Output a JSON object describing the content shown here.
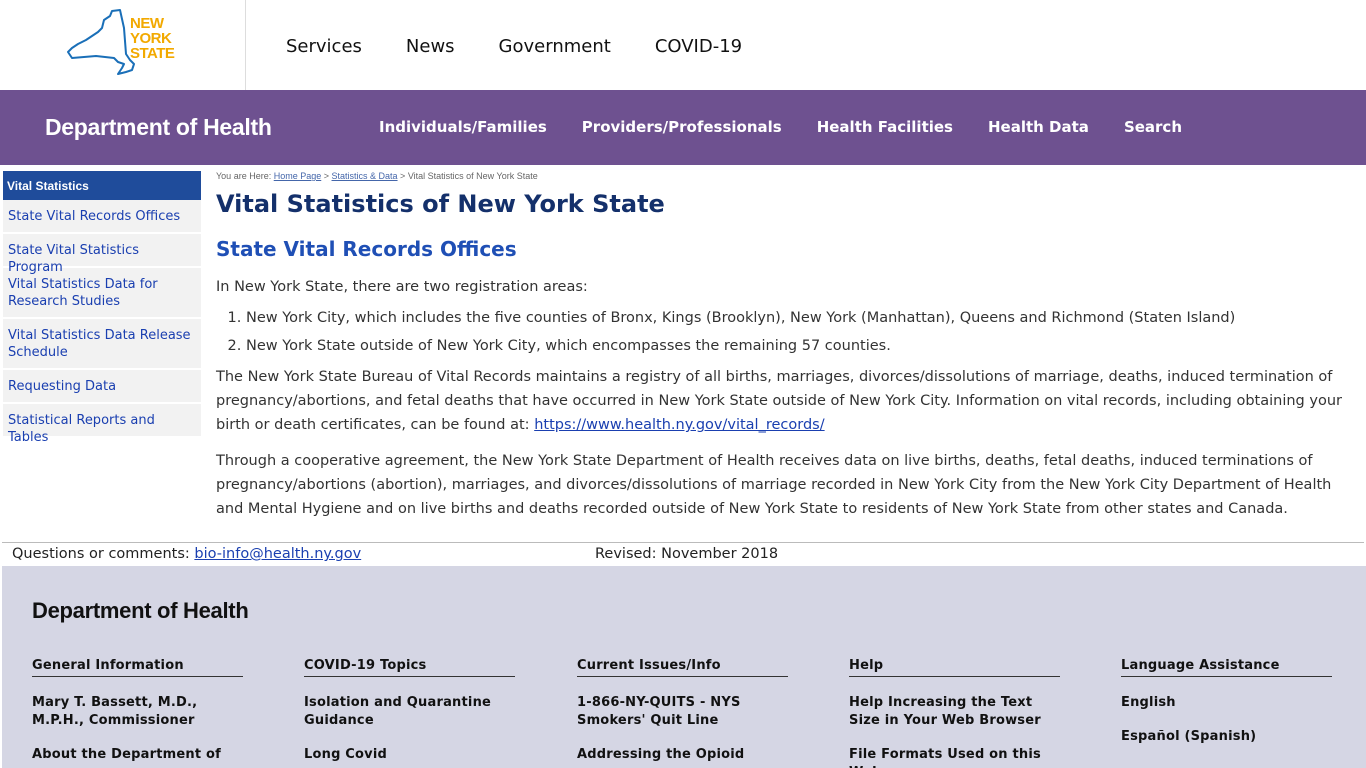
{
  "logo": {
    "line1": "NEW",
    "line2": "YORK",
    "line3": "STATE"
  },
  "top_nav": [
    "Services",
    "News",
    "Government",
    "COVID-19"
  ],
  "dept": {
    "title": "Department of Health",
    "nav": [
      "Individuals/Families",
      "Providers/Professionals",
      "Health Facilities",
      "Health Data",
      "Search"
    ]
  },
  "sidebar": {
    "heading": "Vital Statistics",
    "items": [
      "State Vital Records Offices",
      "State Vital Statistics Program",
      "Vital Statistics Data for Research Studies",
      "Vital Statistics Data Release Schedule",
      "Requesting Data",
      "Statistical Reports and Tables"
    ]
  },
  "breadcrumb": {
    "prefix": "You are Here: ",
    "home": "Home Page",
    "sep1": " > ",
    "stats": "Statistics & Data",
    "sep2": " > ",
    "current": "Vital Statistics of New York State"
  },
  "main": {
    "title": "Vital Statistics of New York State",
    "section": "State Vital Records Offices",
    "intro": "In New York State, there are two registration areas:",
    "list": [
      "New York City, which includes the five counties of Bronx, Kings (Brooklyn), New York (Manhattan), Queens and Richmond (Staten Island)",
      "New York State outside of New York City, which encompasses the remaining 57 counties."
    ],
    "para2": "The New York State Bureau of Vital Records maintains a registry of all births, marriages, divorces/dissolutions of marriage, deaths, induced termination of pregnancy/abortions, and fetal deaths that have occurred in New York State outside of New York City. Information on vital records, including obtaining your birth or death certificates, can be found at: ",
    "para2_link": "https://www.health.ny.gov/vital_records/",
    "para3": "Through a cooperative agreement, the New York State Department of Health receives data on live births, deaths, fetal deaths, induced terminations of pregnancy/abortions (abortion), marriages, and divorces/dissolutions of marriage recorded in New York City from the New York City Department of Health and Mental Hygiene and on live births and deaths recorded outside of New York State to residents of New York State from other states and Canada."
  },
  "questions": {
    "label": "Questions or comments: ",
    "email": "bio-info@health.ny.gov",
    "revised": "Revised: November 2018"
  },
  "footer": {
    "title": "Department of Health",
    "columns": [
      {
        "heading": "General Information",
        "items": [
          "Mary T. Bassett, M.D., M.P.H., Commissioner",
          "About the Department of"
        ]
      },
      {
        "heading": "COVID-19 Topics",
        "items": [
          "Isolation and Quarantine Guidance",
          "Long Covid"
        ]
      },
      {
        "heading": "Current Issues/Info",
        "items": [
          "1-866-NY-QUITS - NYS Smokers' Quit Line",
          "Addressing the Opioid"
        ]
      },
      {
        "heading": "Help",
        "items": [
          "Help Increasing the Text Size in Your Web Browser",
          "File Formats Used on this Web"
        ]
      },
      {
        "heading": "Language Assistance",
        "items": [
          "English",
          "Español (Spanish)"
        ]
      }
    ]
  },
  "colors": {
    "purple": "#6e5190",
    "sidebar_blue": "#1f4c9b",
    "title_navy": "#14306b",
    "link_blue": "#1a3fb0",
    "footer_bg": "#d5d6e4",
    "logo_gold": "#f2a900"
  }
}
